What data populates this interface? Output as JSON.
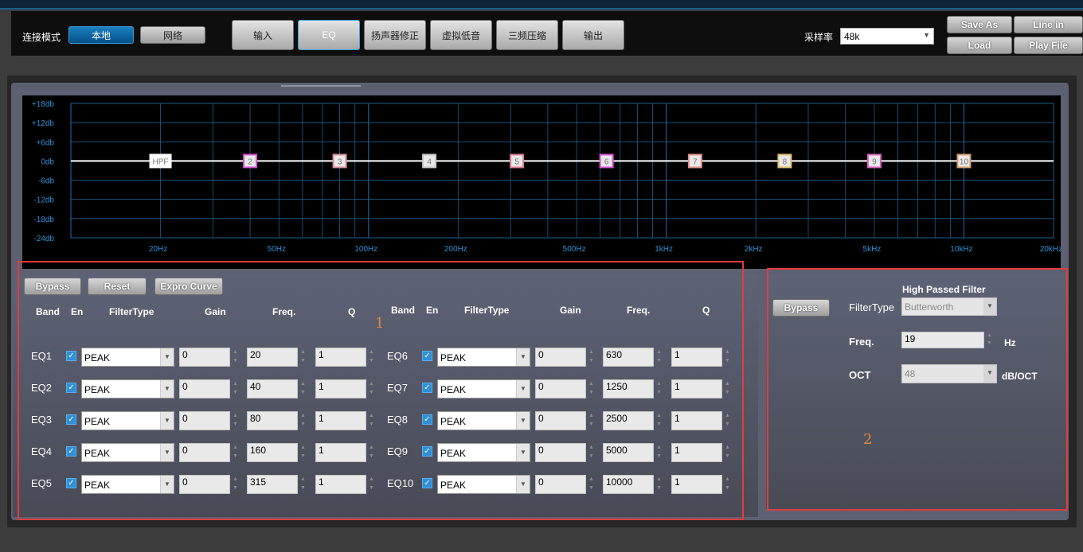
{
  "topbar": {
    "connection_label": "连接模式",
    "mode_local": "本地",
    "mode_network": "网络",
    "tabs": [
      "输入",
      "EQ",
      "扬声器修正",
      "虚拟低音",
      "三频压缩",
      "输出"
    ],
    "active_tab": "EQ",
    "sample_rate_label": "采样率",
    "sample_rate_value": "48k",
    "save_as": "Save As",
    "line_in": "Line in",
    "load": "Load",
    "play_file": "Play File"
  },
  "graph": {
    "y_labels": [
      "+18db",
      "+12db",
      "+6db",
      "0db",
      "-6db",
      "-12db",
      "-18db",
      "-24db"
    ],
    "x_labels": [
      "20Hz",
      "50Hz",
      "100Hz",
      "200Hz",
      "500Hz",
      "1kHz",
      "2kHz",
      "5kHz",
      "10kHz",
      "20kHz"
    ],
    "markers": [
      {
        "label": "HPF",
        "color": "#ffffff"
      },
      {
        "label": "2",
        "color": "#d94fd6"
      },
      {
        "label": "3",
        "color": "#d98f9f"
      },
      {
        "label": "4",
        "color": "#c9c9c9"
      },
      {
        "label": "5",
        "color": "#e27a96"
      },
      {
        "label": "6",
        "color": "#e04fd9"
      },
      {
        "label": "7",
        "color": "#e59090"
      },
      {
        "label": "8",
        "color": "#e3c070"
      },
      {
        "label": "9",
        "color": "#e063c0"
      },
      {
        "label": "10",
        "color": "#d8a070"
      }
    ]
  },
  "eq": {
    "bypass": "Bypass",
    "reset": "Reset",
    "export": "Expro Curve",
    "headers": {
      "band": "Band",
      "en": "En",
      "filter_type": "FilterType",
      "gain": "Gain",
      "freq": "Freq.",
      "q": "Q"
    },
    "bands_left": [
      {
        "name": "EQ1",
        "type": "PEAK",
        "gain": "0",
        "freq": "20",
        "q": "1"
      },
      {
        "name": "EQ2",
        "type": "PEAK",
        "gain": "0",
        "freq": "40",
        "q": "1"
      },
      {
        "name": "EQ3",
        "type": "PEAK",
        "gain": "0",
        "freq": "80",
        "q": "1"
      },
      {
        "name": "EQ4",
        "type": "PEAK",
        "gain": "0",
        "freq": "160",
        "q": "1"
      },
      {
        "name": "EQ5",
        "type": "PEAK",
        "gain": "0",
        "freq": "315",
        "q": "1"
      }
    ],
    "bands_right": [
      {
        "name": "EQ6",
        "type": "PEAK",
        "gain": "0",
        "freq": "630",
        "q": "1"
      },
      {
        "name": "EQ7",
        "type": "PEAK",
        "gain": "0",
        "freq": "1250",
        "q": "1"
      },
      {
        "name": "EQ8",
        "type": "PEAK",
        "gain": "0",
        "freq": "2500",
        "q": "1"
      },
      {
        "name": "EQ9",
        "type": "PEAK",
        "gain": "0",
        "freq": "5000",
        "q": "1"
      },
      {
        "name": "EQ10",
        "type": "PEAK",
        "gain": "0",
        "freq": "10000",
        "q": "1"
      }
    ]
  },
  "hpf": {
    "bypass": "Bypass",
    "title": "High Passed Filter",
    "filter_type_label": "FilterType",
    "filter_type_value": "Butterworth",
    "freq_label": "Freq.",
    "freq_value": "19",
    "freq_unit": "Hz",
    "oct_label": "OCT",
    "oct_value": "48",
    "oct_unit": "dB/OCT"
  },
  "annotations": {
    "box1": "1",
    "box2": "2"
  },
  "colors": {
    "accent": "#1a7fc0",
    "curve": "#ffffff",
    "grid": "#1a5f8f",
    "highlight": "#e23d3d"
  }
}
